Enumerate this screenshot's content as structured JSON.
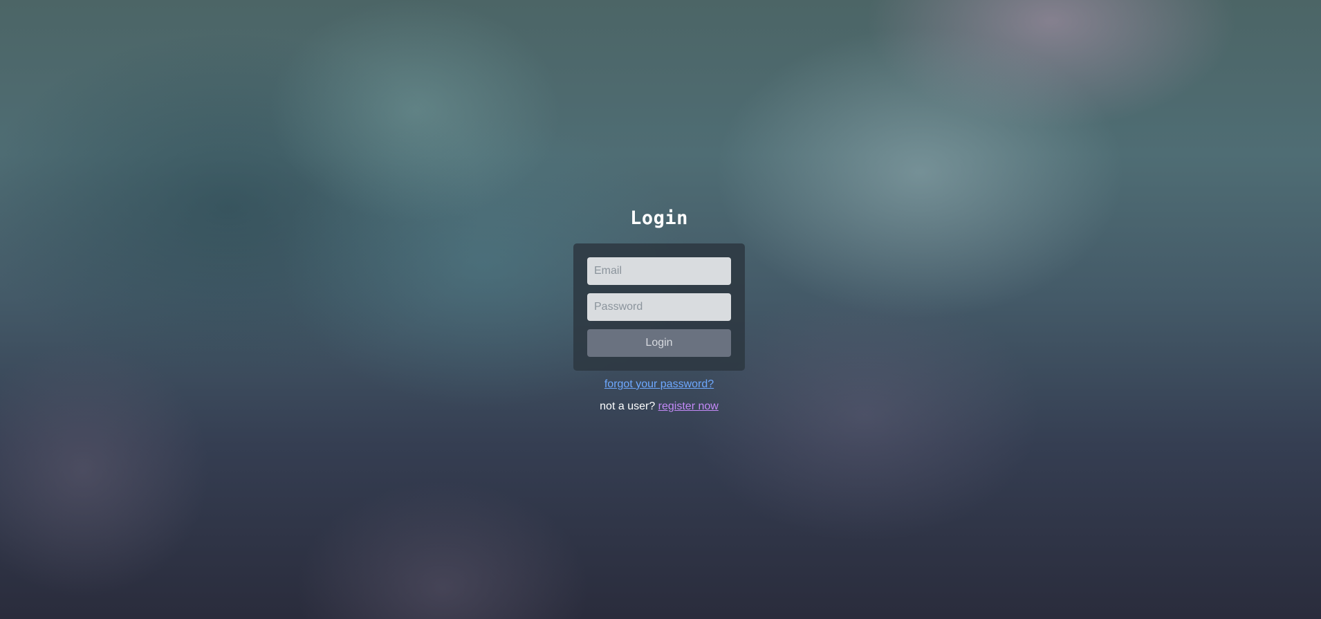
{
  "login": {
    "title": "Login",
    "email_placeholder": "Email",
    "password_placeholder": "Password",
    "submit_label": "Login"
  },
  "links": {
    "forgot_password": "forgot your password?",
    "not_user_text": "not a user?",
    "register": "register now"
  },
  "colors": {
    "panel": "#2d3741",
    "input_background": "#d9dcdf",
    "button_background": "#6a7280",
    "forgot_link": "#6ea8ff",
    "register_link": "#c58af9"
  }
}
